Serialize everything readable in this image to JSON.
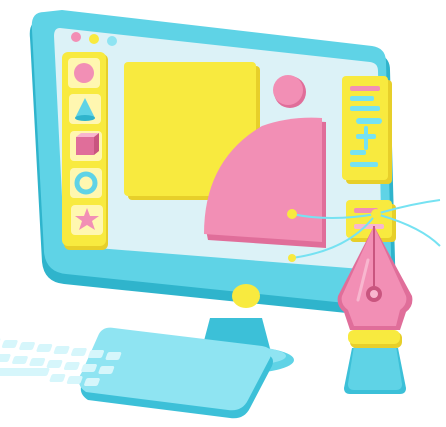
{
  "scene": {
    "subject": "3d-desktop-design-illustration",
    "colors": {
      "monitor_body": "#5fd3e6",
      "monitor_shadow": "#2fb4cc",
      "screen_panel": "#dcf2f7",
      "yellow": "#f8ea3f",
      "yellow_dark": "#e7cf2a",
      "pink": "#f28fb5",
      "pink_dark": "#e06e9a",
      "pink_light": "#f8b6cf",
      "cyan": "#76e2f2",
      "keyboard": "#8fe4f2",
      "keyboard_keys": "#d6f6fb",
      "background": "#ffffff"
    },
    "toolbar_icons": [
      "circle-icon",
      "cone-icon",
      "cube-icon",
      "ring-icon",
      "star-icon"
    ],
    "window_dots": [
      "pink",
      "yellow",
      "cyan"
    ]
  }
}
